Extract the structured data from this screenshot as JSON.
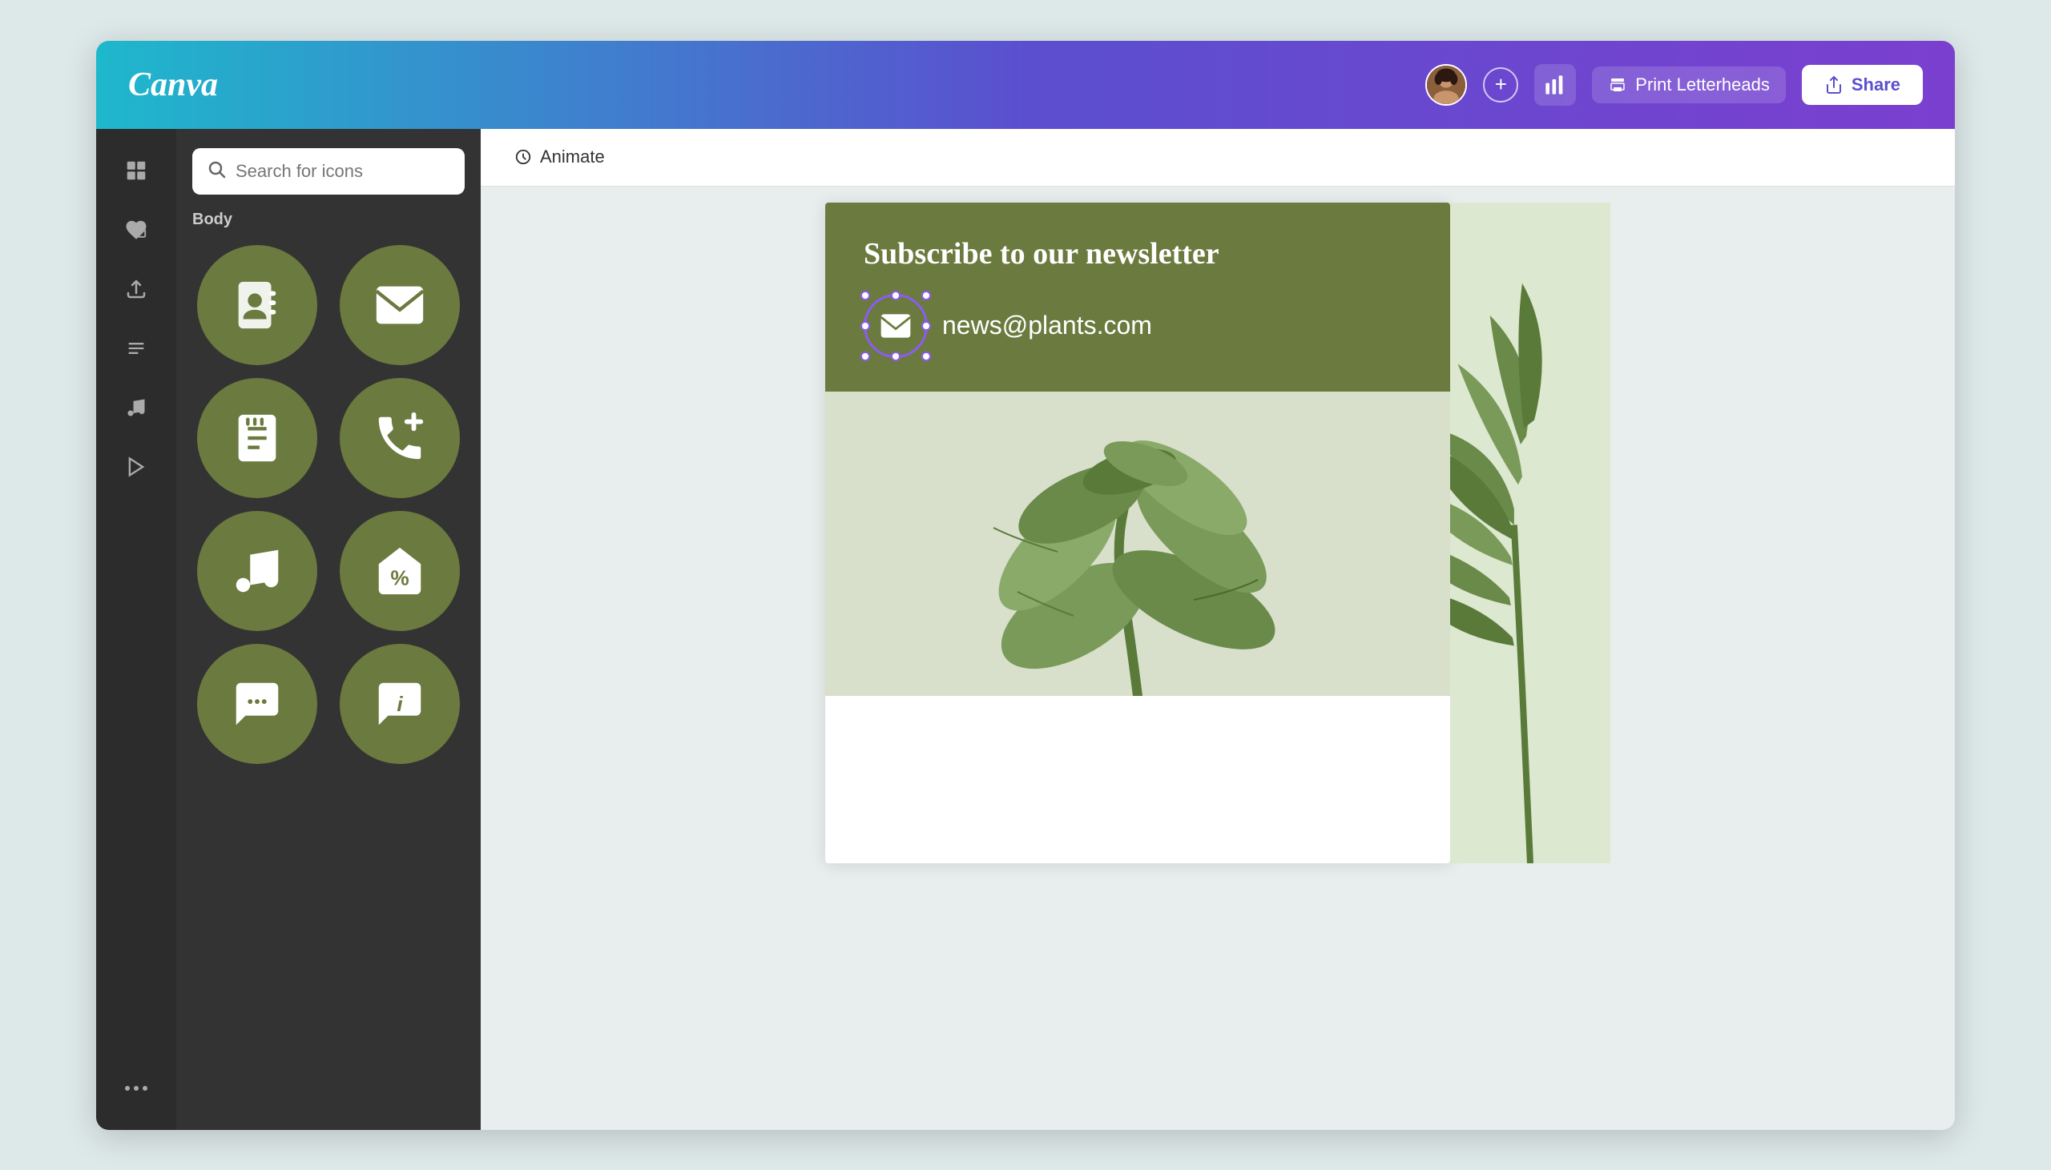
{
  "header": {
    "logo": "Canva",
    "add_label": "+",
    "chart_icon": "chart",
    "print_label": "Print Letterheads",
    "share_label": "Share"
  },
  "sidebar": {
    "items": [
      {
        "id": "grid",
        "icon": "⊞",
        "label": "Grid"
      },
      {
        "id": "elements",
        "icon": "❤",
        "label": "Elements"
      },
      {
        "id": "upload",
        "icon": "↑",
        "label": "Upload"
      },
      {
        "id": "text",
        "icon": "T",
        "label": "Text"
      },
      {
        "id": "music",
        "icon": "♪",
        "label": "Music"
      },
      {
        "id": "video",
        "icon": "▶",
        "label": "Video"
      },
      {
        "id": "more",
        "icon": "•••",
        "label": "More"
      }
    ]
  },
  "icon_panel": {
    "search_placeholder": "Search for icons",
    "section_label": "Body",
    "icons": [
      {
        "id": "contact",
        "label": "Contact Book"
      },
      {
        "id": "mail",
        "label": "Mail"
      },
      {
        "id": "notes",
        "label": "Notes"
      },
      {
        "id": "phone-add",
        "label": "Phone Add"
      },
      {
        "id": "music-note",
        "label": "Music Note"
      },
      {
        "id": "discount",
        "label": "Discount Tag"
      },
      {
        "id": "chat",
        "label": "Chat"
      },
      {
        "id": "info",
        "label": "Info"
      }
    ]
  },
  "canvas": {
    "animate_label": "Animate",
    "newsletter": {
      "title": "Subscribe to our newsletter",
      "email": "news@plants.com"
    }
  }
}
